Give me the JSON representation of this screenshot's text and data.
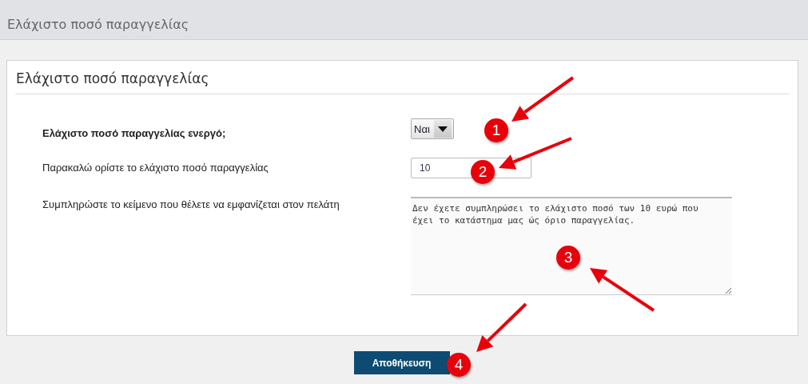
{
  "header": {
    "title": "Ελάχιστο ποσό παραγγελίας"
  },
  "panel": {
    "title": "Ελάχιστο ποσό παραγγελίας",
    "fields": [
      {
        "kind": "select",
        "label": "Ελάχιστο ποσό παραγγελίας ενεργό;",
        "bold": true,
        "value": "Ναι"
      },
      {
        "kind": "input",
        "label": "Παρακαλώ ορίστε το ελάχιστο ποσό παραγγελίας",
        "bold": false,
        "value": "10"
      },
      {
        "kind": "textarea",
        "label": "Συμπληρώστε το κείμενο που θέλετε να εμφανίζεται στον πελάτη",
        "bold": false,
        "value": "Δεν έχετε συμπληρώσει το ελάχιστο ποσό των 10 ευρώ που έχει το κατάστημα μας ώς όριο παραγγελίας."
      }
    ]
  },
  "save_button": {
    "label": "Αποθήκευση"
  },
  "annotations": [
    {
      "number": "1"
    },
    {
      "number": "2"
    },
    {
      "number": "3"
    },
    {
      "number": "4"
    }
  ]
}
